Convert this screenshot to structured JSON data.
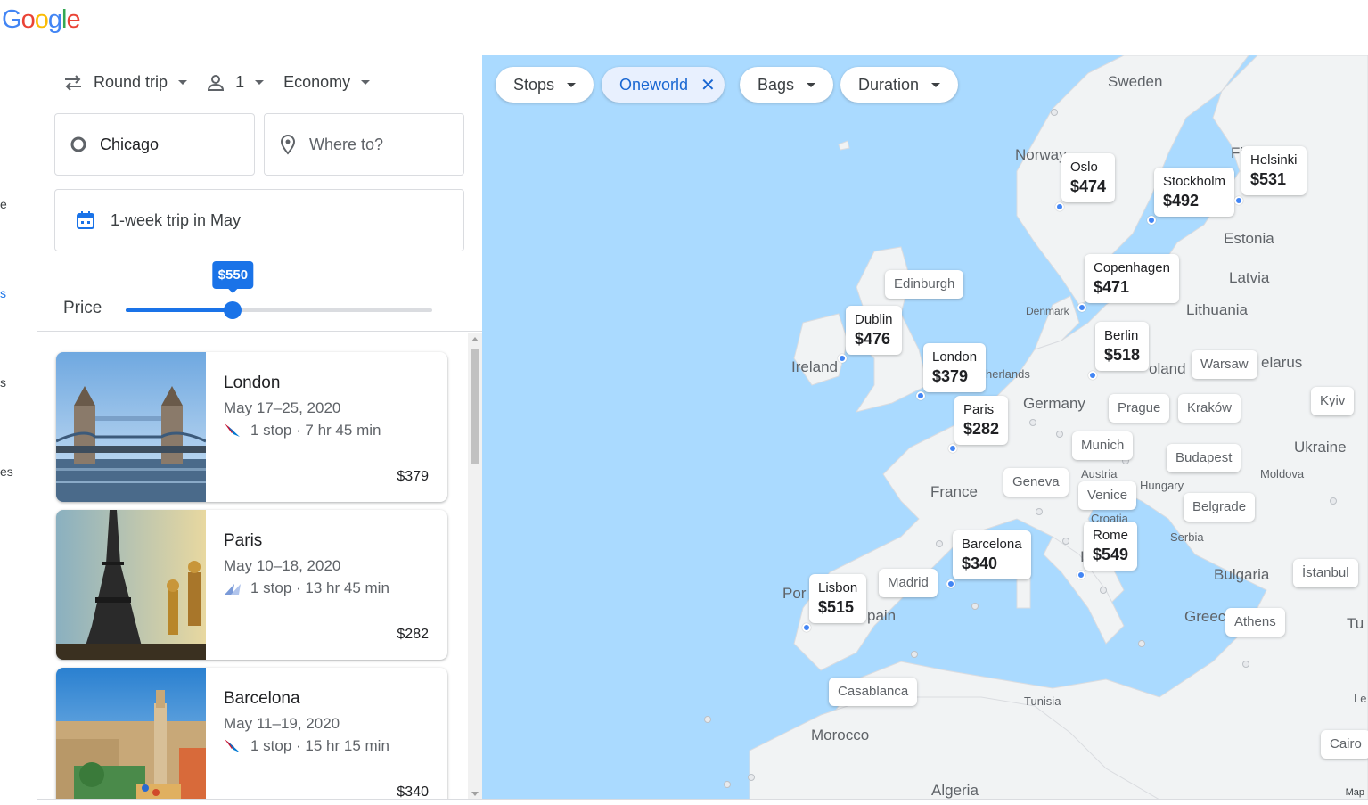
{
  "brand": {
    "name": "Google",
    "letters": [
      {
        "c": "G",
        "color": "#4285f4"
      },
      {
        "c": "o",
        "color": "#ea4335"
      },
      {
        "c": "o",
        "color": "#fbbc05"
      },
      {
        "c": "g",
        "color": "#4285f4"
      },
      {
        "c": "l",
        "color": "#34a853"
      },
      {
        "c": "e",
        "color": "#ea4335"
      }
    ]
  },
  "left_edge": [
    "e",
    "s",
    "s",
    "es"
  ],
  "search": {
    "trip_type": "Round trip",
    "passengers": "1",
    "cabin": "Economy",
    "origin": "Chicago",
    "destination_placeholder": "Where to?",
    "dates": "1-week trip in May",
    "price_label": "Price",
    "price_max": "$550",
    "price_fraction": 0.35
  },
  "results": [
    {
      "city": "London",
      "dates": "May 17–25, 2020",
      "flight": "1 stop · 7 hr 45 min",
      "price": "$379"
    },
    {
      "city": "Paris",
      "dates": "May 10–18, 2020",
      "flight": "1 stop · 13 hr 45 min",
      "price": "$282"
    },
    {
      "city": "Barcelona",
      "dates": "May 11–19, 2020",
      "flight": "1 stop · 15 hr 15 min",
      "price": "$340"
    }
  ],
  "filters": {
    "stops": "Stops",
    "alliance": "Oneworld",
    "bags": "Bags",
    "duration": "Duration"
  },
  "map": {
    "places": {
      "sweden": "Sweden",
      "norway": "Norway",
      "finland": "Fi",
      "estonia": "Estonia",
      "latvia": "Latvia",
      "lithuania": "Lithuania",
      "denmark": "Denmark",
      "ireland": "Ireland",
      "uk": "d\nm",
      "netherlands": "herlands",
      "germany": "Germany",
      "poland": "oland",
      "belarus": "elarus",
      "ukraine": "Ukraine",
      "moldova": "Moldova",
      "austria": "Austria",
      "hungary": "Hungary",
      "croatia": "Croatia",
      "serbia": "Serbia",
      "france": "France",
      "italy": "Ita",
      "spain": "pain",
      "portugal": "Por",
      "bulgaria": "Bulgaria",
      "greece": "Greec",
      "turkey": "Tu",
      "tunisia": "Tunisia",
      "morocco": "Morocco",
      "algeria": "Algeria",
      "libya": "Le"
    },
    "priced_pins": [
      {
        "n": "Oslo",
        "p": "$474"
      },
      {
        "n": "Stockholm",
        "p": "$492"
      },
      {
        "n": "Helsinki",
        "p": "$531"
      },
      {
        "n": "Copenhagen",
        "p": "$471"
      },
      {
        "n": "Dublin",
        "p": "$476"
      },
      {
        "n": "London",
        "p": "$379"
      },
      {
        "n": "Berlin",
        "p": "$518"
      },
      {
        "n": "Paris",
        "p": "$282"
      },
      {
        "n": "Barcelona",
        "p": "$340"
      },
      {
        "n": "Rome",
        "p": "$549"
      },
      {
        "n": "Lisbon",
        "p": "$515"
      }
    ],
    "other_pins": [
      "Edinburgh",
      "Warsaw",
      "Kyiv",
      "Prague",
      "Kraków",
      "Munich",
      "Budapest",
      "Geneva",
      "Venice",
      "Belgrade",
      "Madrid",
      "İstanbul",
      "Athens",
      "Casablanca",
      "Cairo"
    ],
    "credit": "Map"
  },
  "colors": {
    "accent": "#1a73e8",
    "water": "#aadaff",
    "land": "#f5f5f5"
  },
  "icons": {
    "trip": "swap-arrows-icon",
    "person": "person-icon",
    "origin": "circle-icon",
    "destination": "location-pin-icon",
    "calendar": "calendar-icon"
  }
}
